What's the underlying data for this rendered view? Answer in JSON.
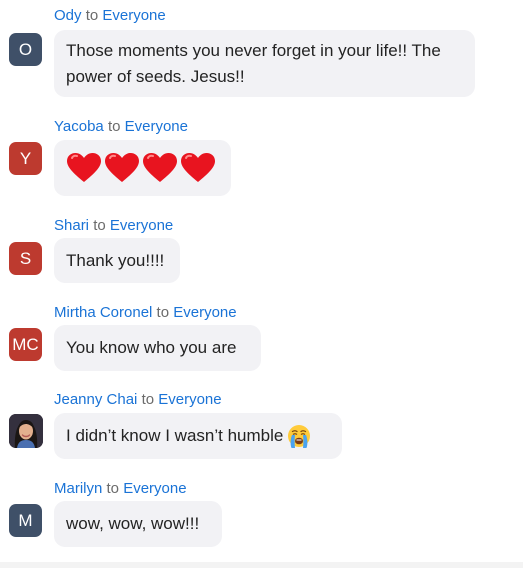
{
  "chat": {
    "to_word": "to",
    "messages": [
      {
        "sender": "Ody",
        "recipient": "Everyone",
        "avatar_initials": "O",
        "avatar_color": "#3f5068",
        "text": "Those moments you never forget in your life!! The power of seeds. Jesus!!"
      },
      {
        "sender": "Yacoba",
        "recipient": "Everyone",
        "avatar_initials": "Y",
        "avatar_color": "#bd3a2f",
        "emoji": [
          "red-heart",
          "red-heart",
          "red-heart",
          "red-heart"
        ]
      },
      {
        "sender": "Shari",
        "recipient": "Everyone",
        "avatar_initials": "S",
        "avatar_color": "#bd3a2f",
        "text": "Thank you!!!!"
      },
      {
        "sender": "Mirtha Coronel",
        "recipient": "Everyone",
        "avatar_initials": "MC",
        "avatar_color": "#bd3a2f",
        "text": "You know who you are"
      },
      {
        "sender": "Jeanny Chai",
        "recipient": "Everyone",
        "avatar_type": "photo",
        "text": "I didn’t know I wasn’t humble",
        "trailing_emoji": "loudly-crying-face"
      },
      {
        "sender": "Marilyn",
        "recipient": "Everyone",
        "avatar_initials": "M",
        "avatar_color": "#3f5068",
        "text": "wow, wow, wow!!!"
      }
    ]
  },
  "colors": {
    "name_link": "#1a73d6",
    "bubble_bg": "#f2f2f5",
    "to_text": "#6b6b6b"
  }
}
